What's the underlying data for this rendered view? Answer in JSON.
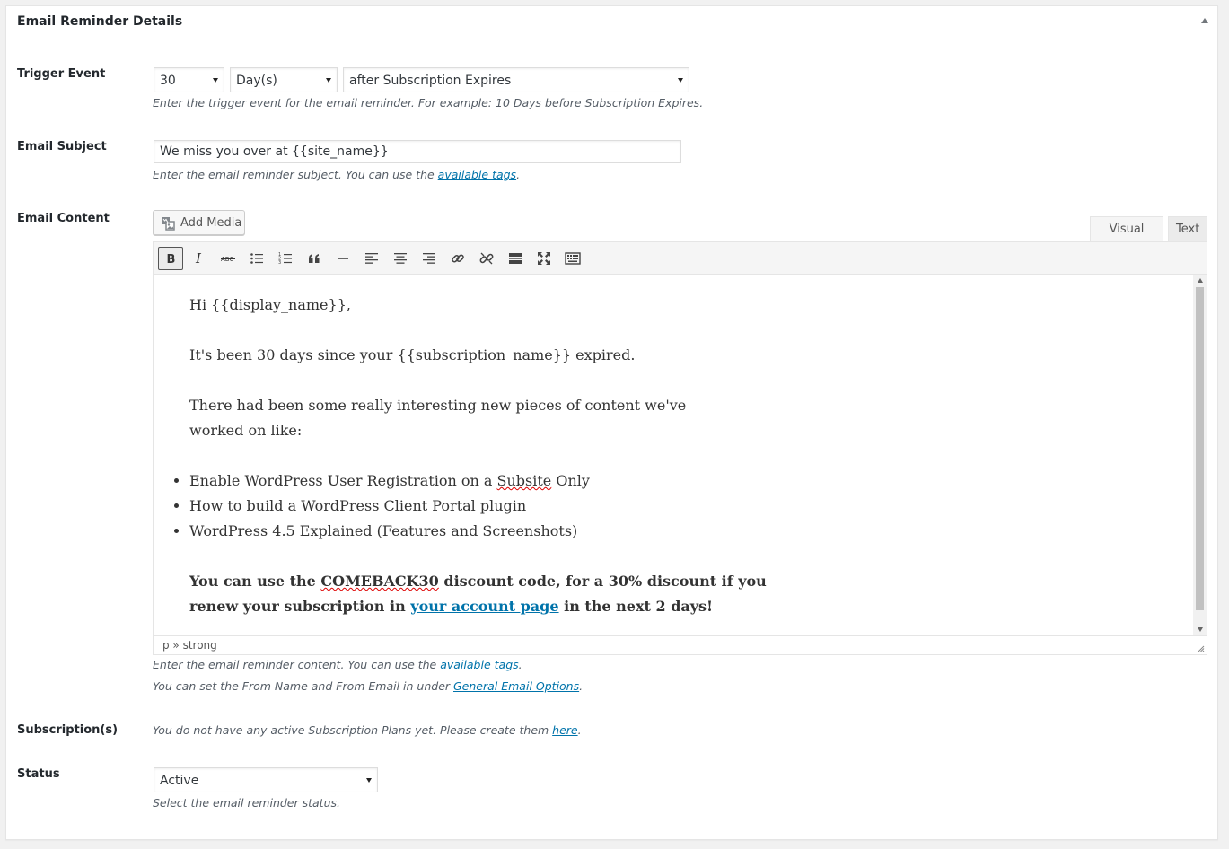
{
  "panel": {
    "title": "Email Reminder Details"
  },
  "trigger": {
    "label": "Trigger Event",
    "count": "30",
    "unit": "Day(s)",
    "event": "after Subscription Expires",
    "description": "Enter the trigger event for the email reminder. For example: 10 Days before Subscription Expires."
  },
  "subject": {
    "label": "Email Subject",
    "value": "We miss you over at {{site_name}}",
    "description_prefix": "Enter the email reminder subject. You can use the ",
    "description_link": "available tags",
    "description_suffix": "."
  },
  "content": {
    "label": "Email Content",
    "add_media": "Add Media",
    "tab_visual": "Visual",
    "tab_text": "Text",
    "toolbar": [
      "bold-icon",
      "italic-icon",
      "strikethrough-icon",
      "bullet-list-icon",
      "numbered-list-icon",
      "blockquote-icon",
      "horizontal-line-icon",
      "align-left-icon",
      "align-center-icon",
      "align-right-icon",
      "link-icon",
      "unlink-icon",
      "read-more-icon",
      "fullscreen-icon",
      "toolbar-toggle-icon"
    ],
    "body": {
      "greeting": "Hi {{display_name}},",
      "line1": "It's been 30 days since your {{subscription_name}} expired.",
      "line2a": "There had been some really interesting new pieces of content we've",
      "line2b": "worked on like:",
      "item1_a": "Enable WordPress User Registration on a ",
      "item1_b": "Subsite",
      "item1_c": " Only",
      "item2": "How to build a WordPress Client Portal plugin",
      "item3": "WordPress 4.5 Explained (Features and Screenshots)",
      "cta_a": "You can use the ",
      "cta_code": "COMEBACK30",
      "cta_b": " discount code, for a 30% discount if you",
      "cta_c": "renew your subscription in ",
      "cta_link": "your account page",
      "cta_d": " in the next 2 days!"
    },
    "path": "p » strong",
    "description1_prefix": "Enter the email reminder content. You can use the ",
    "description1_link": "available tags",
    "description1_suffix": ".",
    "description2_prefix": "You can set the From Name and From Email in under ",
    "description2_link": "General Email Options",
    "description2_suffix": "."
  },
  "subscriptions": {
    "label": "Subscription(s)",
    "text_prefix": "You do not have any active Subscription Plans yet. Please create them ",
    "text_link": "here",
    "text_suffix": "."
  },
  "status": {
    "label": "Status",
    "value": "Active",
    "description": "Select the email reminder status."
  }
}
